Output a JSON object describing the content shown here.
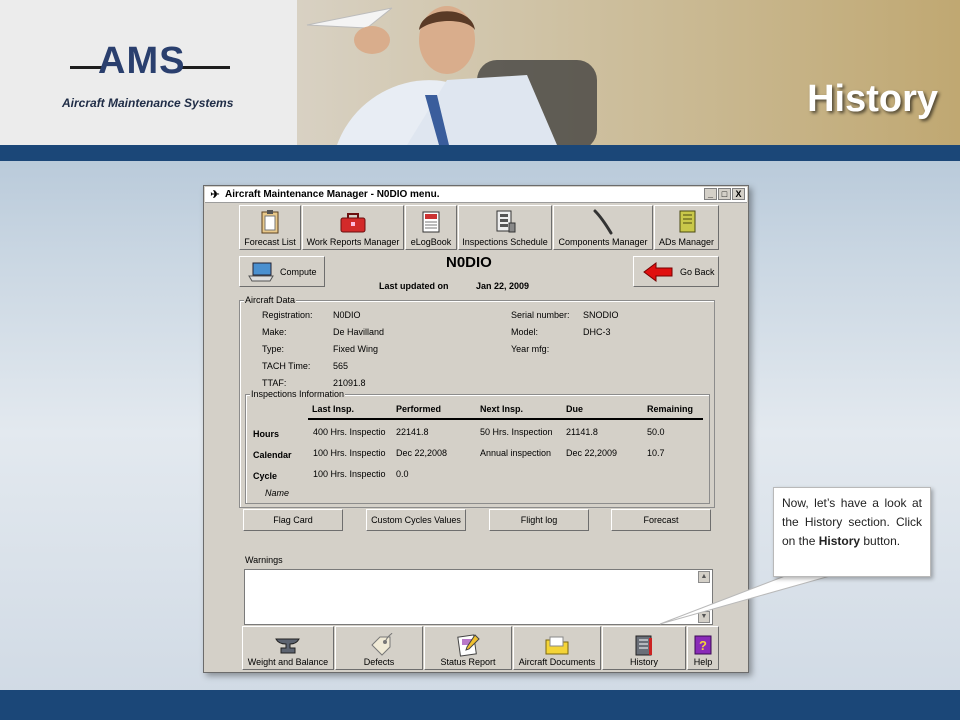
{
  "header": {
    "logo_text": "AMS",
    "logo_subtitle": "Aircraft Maintenance Systems",
    "slide_title": "History"
  },
  "window": {
    "title": "Aircraft Maintenance Manager - N0DIO menu.",
    "controls": [
      "_",
      "□",
      "X"
    ],
    "toolbar": [
      {
        "label": "Forecast List",
        "icon": "clipboard-icon"
      },
      {
        "label": "Work Reports Manager",
        "icon": "toolbox-icon"
      },
      {
        "label": "eLogBook",
        "icon": "logbook-icon"
      },
      {
        "label": "Inspections Schedule",
        "icon": "schedule-icon"
      },
      {
        "label": "Components Manager",
        "icon": "wrench-icon"
      },
      {
        "label": "ADs Manager",
        "icon": "notebook-icon"
      }
    ],
    "compute_label": "Compute",
    "go_back_label": "Go Back",
    "tail_number": "N0DIO",
    "last_updated_label": "Last updated on",
    "last_updated_value": "Jan 22, 2009",
    "aircraft_data": {
      "group_title": "Aircraft Data",
      "left": [
        {
          "label": "Registration:",
          "value": "N0DIO"
        },
        {
          "label": "Make:",
          "value": "De Havilland"
        },
        {
          "label": "Type:",
          "value": "Fixed Wing"
        },
        {
          "label": "TACH Time:",
          "value": "565"
        },
        {
          "label": "TTAF:",
          "value": "21091.8"
        }
      ],
      "right": [
        {
          "label": "Serial number:",
          "value": "SNODIO"
        },
        {
          "label": "Model:",
          "value": "DHC-3"
        },
        {
          "label": "Year mfg:",
          "value": ""
        }
      ]
    },
    "inspections": {
      "group_title": "Inspections Information",
      "headers": [
        "Last Insp.",
        "Performed",
        "Next Insp.",
        "Due",
        "Remaining"
      ],
      "rows": [
        {
          "label": "Hours",
          "cells": [
            "400 Hrs. Inspectio",
            "22141.8",
            "50 Hrs. Inspection",
            "21141.8",
            "50.0"
          ]
        },
        {
          "label": "Calendar",
          "cells": [
            "100 Hrs. Inspectio",
            "Dec 22,2008",
            "Annual inspection",
            "Dec 22,2009",
            "10.7"
          ]
        },
        {
          "label": "Cycle",
          "cells": [
            "100 Hrs. Inspectio",
            "0.0",
            "",
            "",
            ""
          ]
        }
      ],
      "name_label": "Name"
    },
    "action_buttons": [
      "Flag Card",
      "Custom Cycles Values",
      "Flight log",
      "Forecast"
    ],
    "warnings_label": "Warnings",
    "bottom_buttons": [
      {
        "label": "Weight and Balance",
        "icon": "anvil-icon"
      },
      {
        "label": "Defects",
        "icon": "tag-icon"
      },
      {
        "label": "Status Report",
        "icon": "report-icon"
      },
      {
        "label": "Aircraft Documents",
        "icon": "folder-icon"
      },
      {
        "label": "History",
        "icon": "history-book-icon"
      },
      {
        "label": "Help",
        "icon": "help-icon"
      }
    ]
  },
  "callout": {
    "text_before": "Now, let’s have a look at the History section. Click on the ",
    "bold": "History",
    "text_after": " button."
  }
}
